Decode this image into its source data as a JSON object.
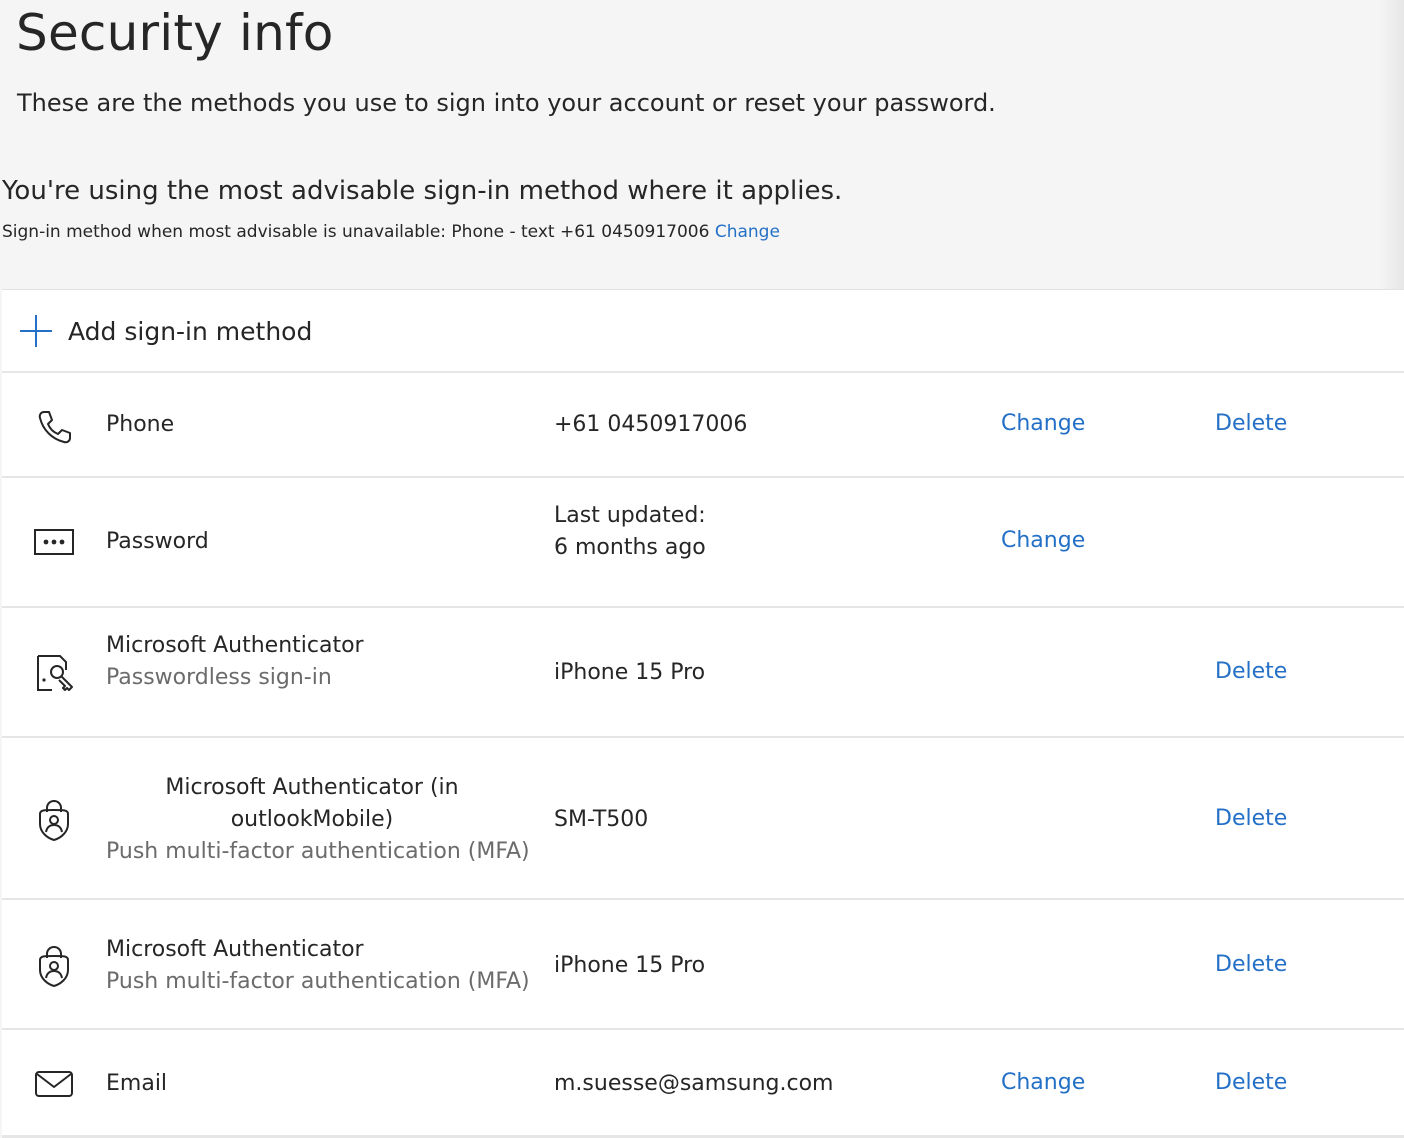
{
  "page": {
    "title": "Security info",
    "subtitle": "These are the methods you use to sign into your account or reset your password.",
    "advisable_heading": "You're using the most advisable sign-in method where it applies.",
    "fallback_text": "Sign-in method when most advisable is unavailable: Phone - text +61 0450917006",
    "fallback_change_label": "Change"
  },
  "add_method": {
    "label": "Add sign-in method",
    "icon": "plus-icon"
  },
  "methods": [
    {
      "icon": "phone-icon",
      "name": "Phone",
      "sub": "",
      "value": "+61 0450917006",
      "value_sub": "",
      "change_label": "Change",
      "delete_label": "Delete"
    },
    {
      "icon": "password-icon",
      "name": "Password",
      "sub": "",
      "value": "Last updated:",
      "value_sub": "6 months ago",
      "change_label": "Change",
      "delete_label": ""
    },
    {
      "icon": "passwordless-key-icon",
      "name": "Microsoft Authenticator",
      "sub": "Passwordless sign-in",
      "value": "iPhone 15 Pro",
      "value_sub": "",
      "change_label": "",
      "delete_label": "Delete"
    },
    {
      "icon": "authenticator-lock-icon",
      "name_line1": "Microsoft Authenticator (in",
      "name_line2": "outlookMobile)",
      "sub": "Push multi-factor authentication (MFA)",
      "value": "SM-T500",
      "value_sub": "",
      "change_label": "",
      "delete_label": "Delete"
    },
    {
      "icon": "authenticator-lock-icon",
      "name": "Microsoft Authenticator",
      "sub": "Push multi-factor authentication (MFA)",
      "value": "iPhone 15 Pro",
      "value_sub": "",
      "change_label": "",
      "delete_label": "Delete"
    },
    {
      "icon": "email-icon",
      "name": "Email",
      "sub": "",
      "value": "m.suesse@samsung.com",
      "value_sub": "",
      "change_label": "Change",
      "delete_label": "Delete"
    }
  ],
  "colors": {
    "accent": "#2470c7",
    "background": "#f5f5f5",
    "card": "#ffffff",
    "secondary_text": "#6b6b6b"
  }
}
